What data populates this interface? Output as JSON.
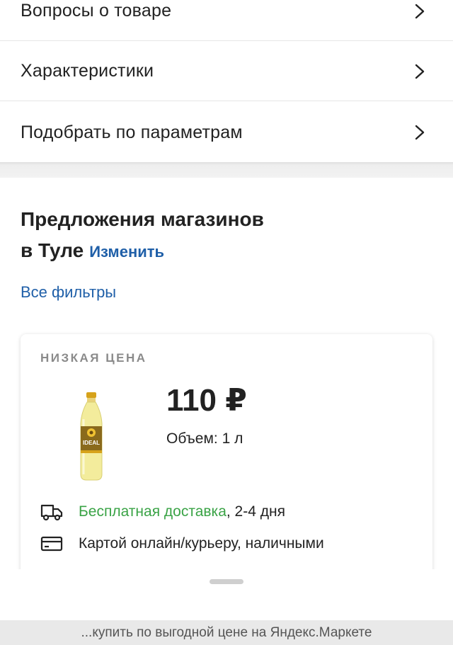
{
  "menu": {
    "items": [
      {
        "label": "Вопросы о товаре"
      },
      {
        "label": "Характеристики"
      },
      {
        "label": "Подобрать по параметрам"
      }
    ]
  },
  "offers": {
    "title_line1": "Предложения магазинов",
    "title_line2": "в Туле",
    "change_link": "Изменить",
    "filters_link": "Все фильтры"
  },
  "offer_card": {
    "badge": "НИЗКАЯ ЦЕНА",
    "price": "110 ₽",
    "volume": "Объем: 1 л",
    "product_brand": "IDEAL",
    "delivery_highlight": "Бесплатная доставка",
    "delivery_rest": ", 2-4 дня",
    "payment": "Картой онлайн/курьеру, наличными"
  },
  "footer": {
    "text": "...купить по выгодной цене на Яндекс.Маркете"
  },
  "colors": {
    "link": "#1f5fa8",
    "delivery_green": "#3aa346",
    "text": "#222222",
    "badge_gray": "#8a8a8a"
  },
  "icons": {
    "menu_arrow": "chevron-right-icon",
    "delivery": "truck-icon",
    "payment": "credit-card-icon"
  }
}
